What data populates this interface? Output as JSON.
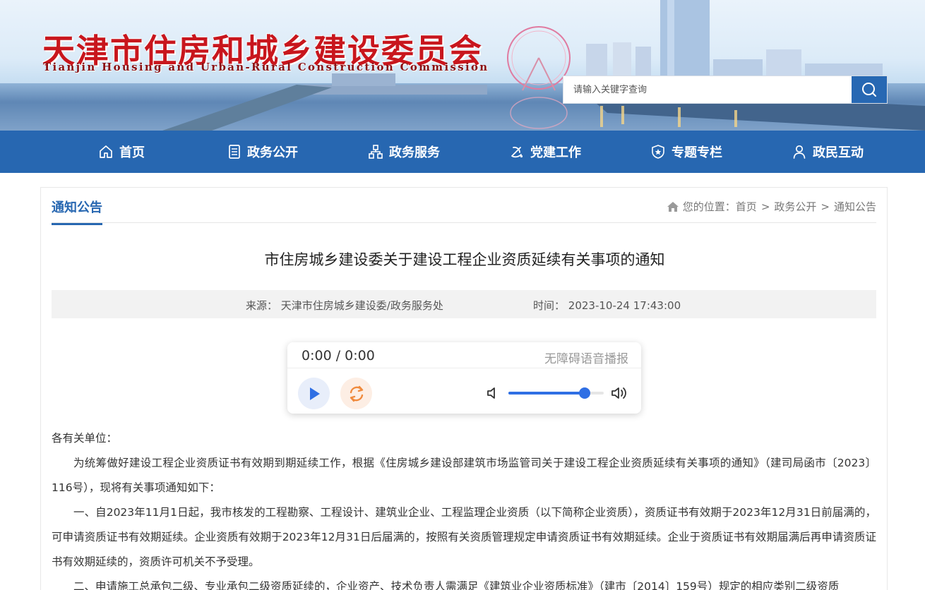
{
  "header": {
    "title_cn": "天津市住房和城乡建设委员会",
    "title_en": "Tianjin Housing and Urban-Rural Construction Commission",
    "search": {
      "placeholder": "请输入关键字查询",
      "icon": "search-icon"
    }
  },
  "nav": {
    "items": [
      {
        "label": "首页",
        "icon": "home-icon"
      },
      {
        "label": "政务公开",
        "icon": "document-icon"
      },
      {
        "label": "政务服务",
        "icon": "service-network-icon"
      },
      {
        "label": "党建工作",
        "icon": "party-emblem-icon"
      },
      {
        "label": "专题专栏",
        "icon": "badge-star-icon"
      },
      {
        "label": "政民互动",
        "icon": "user-icon"
      }
    ],
    "color": "#2767b1"
  },
  "section": {
    "title": "通知公告"
  },
  "breadcrumb": {
    "prefix": "您的位置：",
    "items": [
      "首页",
      "政务公开",
      "通知公告"
    ],
    "separator": ">"
  },
  "article": {
    "title": "市住房城乡建设委关于建设工程企业资质延续有关事项的通知",
    "source_label": "来源：",
    "source": "天津市住房城乡建设委/政务服务处",
    "time_label": "时间：",
    "time": "2023-10-24 17:43:00",
    "salutation": "各有关单位：",
    "paragraphs": [
      "为统筹做好建设工程企业资质证书有效期到期延续工作，根据《住房城乡建设部建筑市场监管司关于建设工程企业资质延续有关事项的通知》（建司局函市〔2023〕116号），现将有关事项通知如下：",
      "一、自2023年11月1日起，我市核发的工程勘察、工程设计、建筑业企业、工程监理企业资质（以下简称企业资质），资质证书有效期于2023年12月31日前届满的，可申请资质证书有效期延续。企业资质有效期于2023年12月31日后届满的，按照有关资质管理规定申请资质证书有效期延续。企业于资质证书有效期届满后再申请资质证书有效期延续的，资质许可机关不予受理。",
      "二、申请施工总承包二级、专业承包二级资质延续的，企业资产、技术负责人需满足《建筑业企业资质标准》（建市〔2014〕159号）规定的相应类别二级资质"
    ]
  },
  "player": {
    "current_time": "0:00",
    "duration": "0:00",
    "separator": "/",
    "label": "无障碍语音播报",
    "volume": 0.8,
    "accent": "#2f6fe4"
  }
}
